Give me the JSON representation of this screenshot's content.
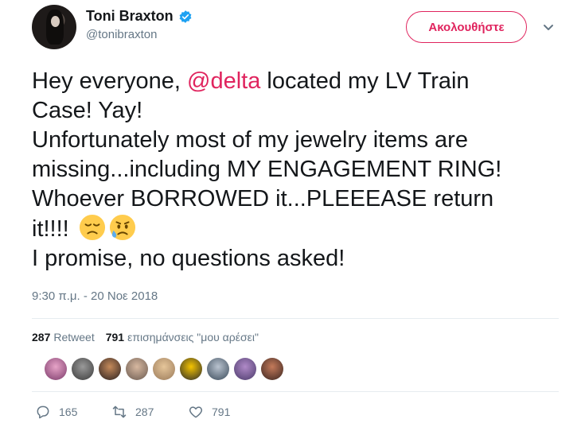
{
  "author": {
    "display_name": "Toni Braxton",
    "handle": "@tonibraxton",
    "verified": true
  },
  "follow_button": {
    "label": "Ακολουθήστε"
  },
  "tweet": {
    "line1_before": "Hey everyone, ",
    "mention": "@delta",
    "line1_after": " located my LV Train",
    "line2": "Case! Yay!",
    "line3": "Unfortunately most of my jewelry items are",
    "line4": "missing...including MY ENGAGEMENT RING!",
    "line5": "Whoever BORROWED it...PLEEEASE return",
    "line6": "it!!!! ",
    "line7": "I promise, no questions asked!",
    "emojis": [
      "disappointed-face",
      "sad-but-relieved-face"
    ]
  },
  "timestamp": "9:30 π.μ. - 20 Νοε 2018",
  "stats": {
    "retweet_count": "287",
    "retweet_label": "Retweet",
    "like_count": "791",
    "like_label": "επισημάνσεις \"μου αρέσει\""
  },
  "likers_count_shown": 9,
  "actions": {
    "reply_count": "165",
    "retweet_count": "287",
    "like_count": "791"
  },
  "colors": {
    "accent": "#e0245e",
    "verified": "#1da1f2",
    "muted": "#657786",
    "text": "#14171a"
  }
}
